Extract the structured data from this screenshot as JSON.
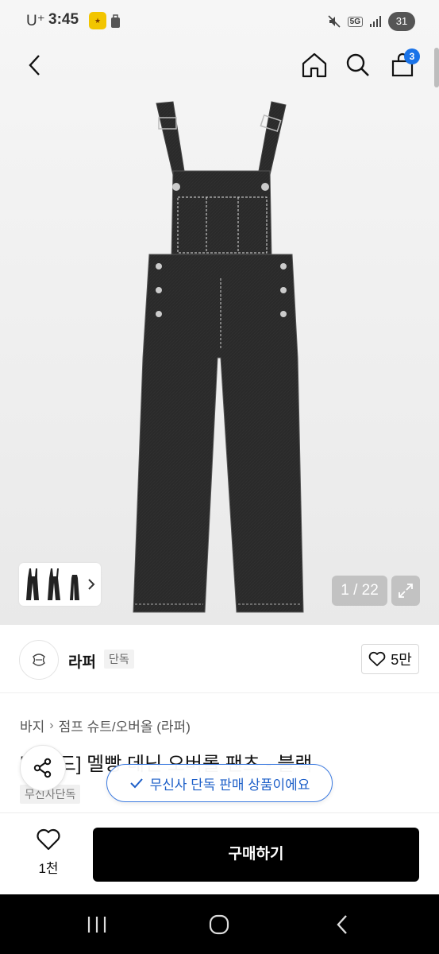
{
  "status_bar": {
    "carrier": "U⁺",
    "time": "3:45",
    "app_icon_text": "ᅵ",
    "network": "5G",
    "battery": "31"
  },
  "nav": {
    "cart_count": "3"
  },
  "gallery": {
    "counter": "1 / 22",
    "background_color": "#eeeeee",
    "product_color": "#2b2b2b"
  },
  "brand": {
    "name": "라퍼",
    "badge": "단독",
    "likes": "5만"
  },
  "breadcrumb": {
    "items": [
      "바지",
      "점프 슈트/오버올 (라퍼)"
    ]
  },
  "product": {
    "title": "[ ] 이드] 멜빵 데닌 오버롤 팬츠 - 블랙",
    "tag": "무신사단독"
  },
  "toast": {
    "text": "무신사 단독 판매 상품이에요"
  },
  "action_bar": {
    "wish_count": "1천",
    "buy_label": "구매하기",
    "buy_color": "#000000"
  },
  "icons": {
    "back": "chevron-left-icon",
    "home": "home-icon",
    "search": "search-icon",
    "cart": "shopping-bag-icon",
    "share": "share-icon",
    "heart": "heart-icon",
    "expand": "expand-icon"
  }
}
